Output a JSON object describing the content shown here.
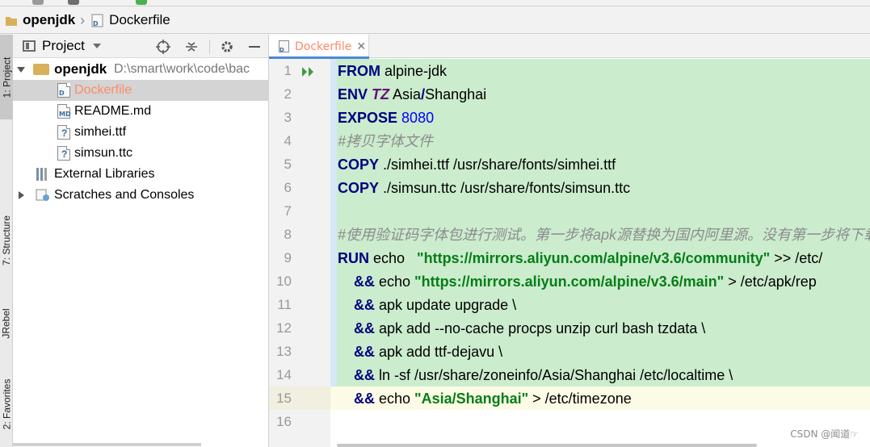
{
  "breadcrumb": {
    "project": "openjdk",
    "file": "Dockerfile"
  },
  "left_strip": {
    "project_tab": "1: Project",
    "structure_tab": "7: Structure",
    "jrebel_tab": "JRebel",
    "favorites_tab": "2: Favorites"
  },
  "project_panel": {
    "title": "Project",
    "tree": {
      "root_name": "openjdk",
      "root_path": "D:\\smart\\work\\code\\bac",
      "files": [
        "Dockerfile",
        "README.md",
        "simhei.ttf",
        "simsun.ttc"
      ],
      "external_libraries": "External Libraries",
      "scratches": "Scratches and Consoles"
    }
  },
  "editor": {
    "tab_label": "Dockerfile",
    "line_numbers": [
      "1",
      "2",
      "3",
      "4",
      "5",
      "6",
      "7",
      "8",
      "9",
      "10",
      "11",
      "12",
      "13",
      "14",
      "15",
      "16"
    ],
    "lines": {
      "l1_kw": "FROM",
      "l1_rest": " alpine-jdk",
      "l2_kw": "ENV",
      "l2_var": "TZ",
      "l2_rest1": " Asia",
      "l2_slash": "/",
      "l2_rest2": "Shanghai",
      "l3_kw": "EXPOSE",
      "l3_num": "8080",
      "l4_comment": "#拷贝字体文件",
      "l5_kw": "COPY",
      "l5_rest": " ./simhei.ttf /usr/share/fonts/simhei.ttf",
      "l6_kw": "COPY",
      "l6_rest": " ./simsun.ttc /usr/share/fonts/simsun.ttc",
      "l8_comment": "#使用验证码字体包进行测试。第一步将apk源替换为国内阿里源。没有第一步将下载",
      "l9_kw": "RUN",
      "l9_rest": " echo   ",
      "l9_str": "\"https://mirrors.aliyun.com/alpine/v3.6/community\"",
      "l9_tail": " >> /etc/",
      "l10_op": "&&",
      "l10_rest": " echo ",
      "l10_str": "\"https://mirrors.aliyun.com/alpine/v3.6/main\"",
      "l10_tail": " > /etc/apk/rep",
      "l11_op": "&&",
      "l11_rest": " apk update upgrade \\",
      "l12_op": "&&",
      "l12_rest": " apk add --no-cache procps unzip curl bash tzdata \\",
      "l13_op": "&&",
      "l13_rest": " apk add ttf-dejavu \\",
      "l14_op": "&&",
      "l14_rest": " ln -sf /usr/share/zoneinfo/Asia/Shanghai /etc/localtime \\",
      "l15_op": "&&",
      "l15_rest": " echo ",
      "l15_str": "\"Asia/Shanghai\"",
      "l15_tail": " > /etc/timezone"
    }
  },
  "watermark": "CSDN @闻道☞"
}
